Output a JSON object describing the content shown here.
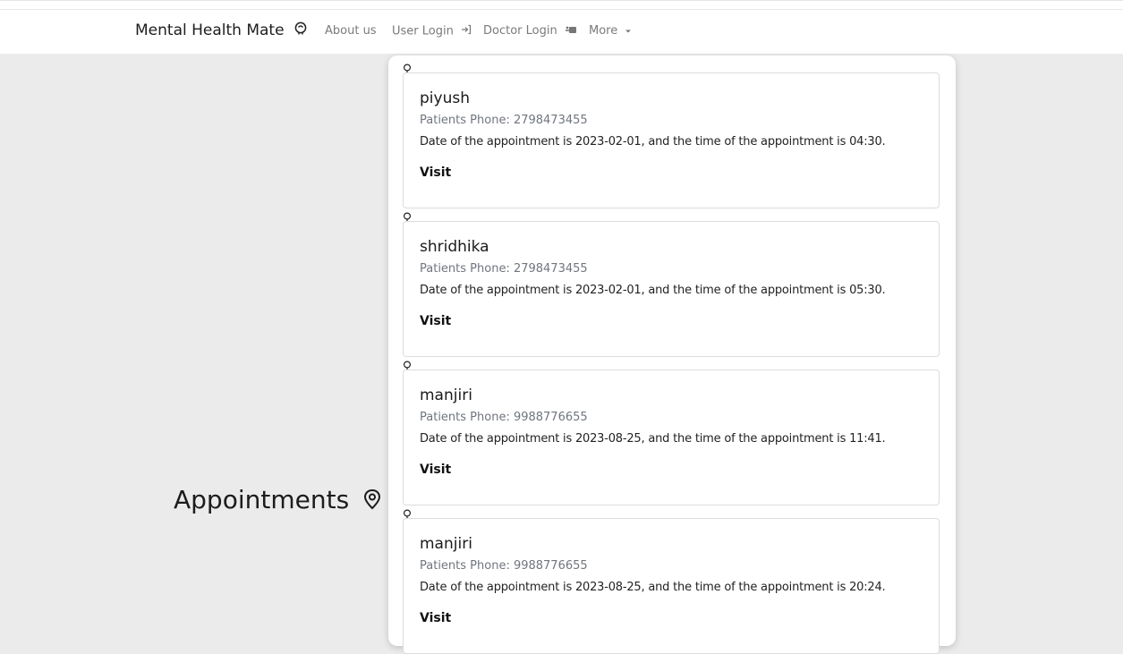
{
  "navbar": {
    "brand": "Mental Health Mate",
    "links": {
      "about": "About us",
      "user_login": "User Login",
      "doctor_login": "Doctor Login",
      "more": "More"
    }
  },
  "page": {
    "heading": "Appointments"
  },
  "appointments": [
    {
      "name": "piyush",
      "phone": "Patients Phone: 2798473455",
      "description": "Date of the appointment is 2023-02-01, and the time of the appointment is 04:30.",
      "action": "Visit"
    },
    {
      "name": "shridhika",
      "phone": "Patients Phone: 2798473455",
      "description": "Date of the appointment is 2023-02-01, and the time of the appointment is 05:30.",
      "action": "Visit"
    },
    {
      "name": "manjiri",
      "phone": "Patients Phone: 9988776655",
      "description": "Date of the appointment is 2023-08-25, and the time of the appointment is 11:41.",
      "action": "Visit"
    },
    {
      "name": "manjiri",
      "phone": "Patients Phone: 9988776655",
      "description": "Date of the appointment is 2023-08-25, and the time of the appointment is 20:24.",
      "action": "Visit"
    }
  ]
}
